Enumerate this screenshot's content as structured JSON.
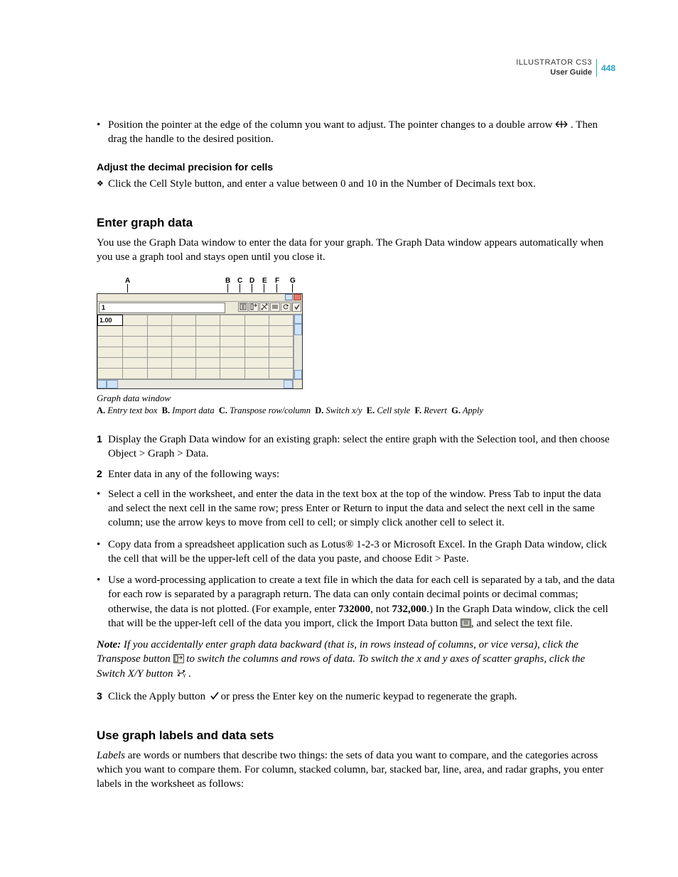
{
  "header": {
    "product": "ILLUSTRATOR CS3",
    "subtitle": "User Guide",
    "page_number": "448"
  },
  "intro_bullets": [
    {
      "pre": "Position the pointer at the edge of the column you want to adjust. The pointer changes to a double arrow ",
      "post": ". Then drag the handle to the desired position."
    }
  ],
  "adjust": {
    "heading": "Adjust the decimal precision for cells",
    "text": "Click the Cell Style button, and enter a value between 0 and 10 in the Number of Decimals text box."
  },
  "enter": {
    "heading": "Enter graph data",
    "intro": "You use the Graph Data window to enter the data for your graph. The Graph Data window appears automatically when you use a graph tool and stays open until you close it.",
    "figure": {
      "callouts": [
        "A",
        "B",
        "C",
        "D",
        "E",
        "F",
        "G"
      ],
      "entry_value": "1",
      "cell_value": "1.00",
      "caption": "Graph data window",
      "legend": [
        {
          "letter": "A.",
          "text": "Entry text box"
        },
        {
          "letter": "B.",
          "text": "Import data"
        },
        {
          "letter": "C.",
          "text": "Transpose row/column"
        },
        {
          "letter": "D.",
          "text": "Switch x/y"
        },
        {
          "letter": "E.",
          "text": "Cell style"
        },
        {
          "letter": "F.",
          "text": "Revert"
        },
        {
          "letter": "G.",
          "text": "Apply"
        }
      ]
    },
    "steps": {
      "s1": {
        "num": "1",
        "text": "Display the Graph Data window for an existing graph: select the entire graph with the Selection tool, and then choose Object > Graph > Data."
      },
      "s2": {
        "num": "2",
        "text": "Enter data in any of the following ways:"
      },
      "s2_bullets": [
        "Select a cell in the worksheet, and enter the data in the text box at the top of the window. Press Tab to input the data and select the next cell in the same row; press Enter or Return to input the data and select the next cell in the same column; use the arrow keys to move from cell to cell; or simply click another cell to select it.",
        "Copy data from a spreadsheet application such as Lotus® 1-2-3 or Microsoft Excel. In the Graph Data window, click the cell that will be the upper-left cell of the data you paste, and choose Edit > Paste."
      ],
      "s2_bullet3": {
        "pre": "Use a word-processing application to create a text file in which the data for each cell is separated by a tab, and the data for each row is separated by a paragraph return. The data can only contain decimal points or decimal commas; otherwise, the data is not plotted. (For example, enter ",
        "bold1": "732000",
        "mid": ", not ",
        "bold2": "732,000",
        "post": ".) In the Graph Data window, click the cell that will be the upper-left cell of the data you import, click the Import Data button ",
        "tail": ", and select the text file."
      },
      "note": {
        "label": "Note:",
        "pre": " If you accidentally enter graph data backward (that is, in rows instead of columns, or vice versa), click the Transpose button ",
        "mid": " to switch the columns and rows of data. To switch the x and y axes of scatter graphs, click the Switch X/Y button ",
        "post": "."
      },
      "s3": {
        "num": "3",
        "pre": "Click the Apply button ",
        "post": " or press the Enter key on the numeric keypad to regenerate the graph."
      }
    }
  },
  "labels_sect": {
    "heading": "Use graph labels and data sets",
    "para_lead": "Labels",
    "para_body": " are words or numbers that describe two things: the sets of data you want to compare, and the categories across which you want to compare them. For column, stacked column, bar, stacked bar, line, area, and radar graphs, you enter labels in the worksheet as follows:"
  }
}
